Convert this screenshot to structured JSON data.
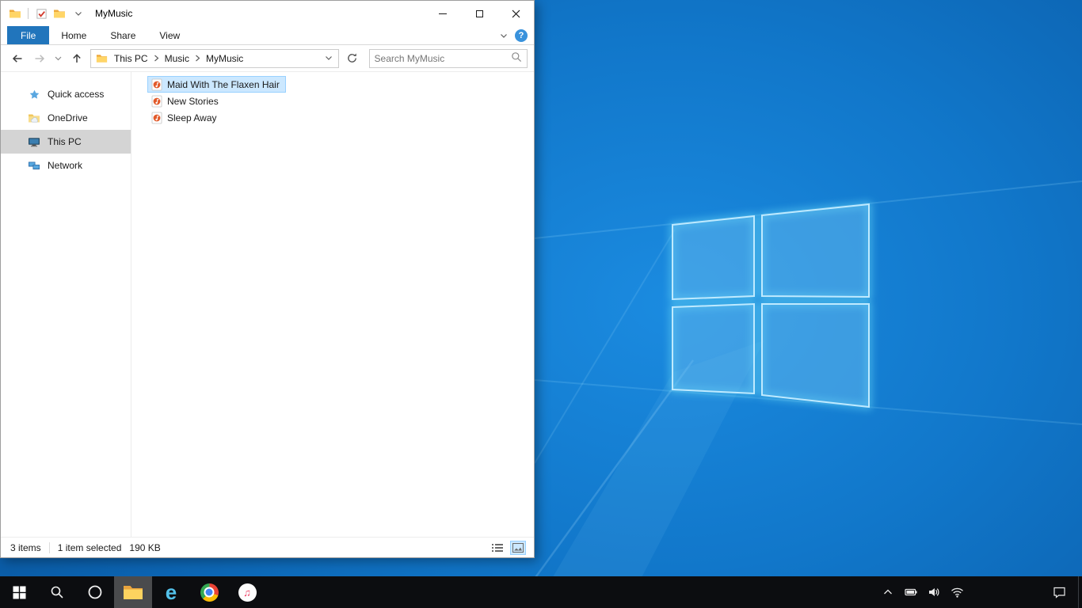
{
  "window": {
    "title": "MyMusic",
    "ribbon": {
      "file_tab": "File",
      "tabs": [
        "Home",
        "Share",
        "View"
      ],
      "help_glyph": "?"
    },
    "address": {
      "segments": [
        "This PC",
        "Music",
        "MyMusic"
      ],
      "search_placeholder": "Search MyMusic",
      "search_value": ""
    },
    "sidebar": {
      "items": [
        {
          "label": "Quick access",
          "icon": "star-icon"
        },
        {
          "label": "OneDrive",
          "icon": "onedrive-cloud-icon"
        },
        {
          "label": "This PC",
          "icon": "computer-icon",
          "selected": true
        },
        {
          "label": "Network",
          "icon": "network-icon"
        }
      ]
    },
    "files": [
      {
        "name": "Maid With The Flaxen Hair",
        "icon": "audio-file-icon",
        "selected": true
      },
      {
        "name": "New Stories",
        "icon": "audio-file-icon",
        "selected": false
      },
      {
        "name": "Sleep Away",
        "icon": "audio-file-icon",
        "selected": false
      }
    ],
    "statusbar": {
      "items_count": "3 items",
      "selection": "1 item selected",
      "selection_size": "190 KB"
    }
  },
  "taskbar": {
    "buttons": [
      "start",
      "search",
      "cortana",
      "file-explorer",
      "internet-explorer",
      "chrome",
      "itunes"
    ],
    "active_button": "file-explorer",
    "tray": [
      "hidden-icons",
      "battery",
      "volume",
      "network",
      "action-center"
    ],
    "glyphs": {
      "internet_explorer": "e",
      "itunes_note": "♫"
    }
  },
  "colors": {
    "accent_blue": "#2175bc",
    "selection_bg": "#cce8ff",
    "selection_border": "#99d1ff",
    "sidebar_selected_bg": "#d4d4d4",
    "taskbar_bg": "#0c0d10",
    "wallpaper_blue": "#1177ca",
    "logo_glow": "#5fd0f3"
  }
}
